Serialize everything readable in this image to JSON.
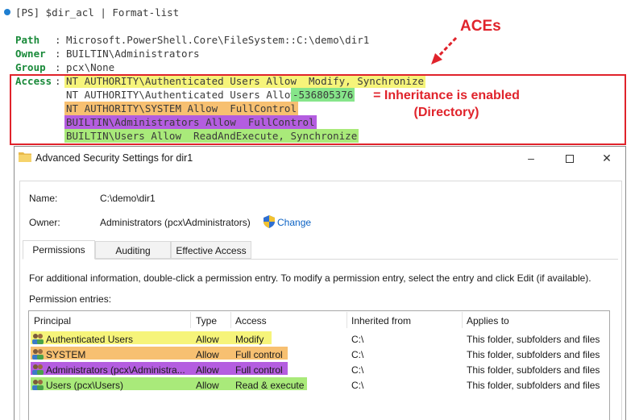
{
  "console": {
    "prompt": "[PS] $dir_acl | Format-list",
    "path_key": "Path",
    "path_value": "Microsoft.PowerShell.Core\\FileSystem::C:\\demo\\dir1",
    "owner_key": "Owner",
    "owner_value": "BUILTIN\\Administrators",
    "group_key": "Group",
    "group_value": "pcx\\None",
    "access_key": "Access",
    "aces": [
      "NT AUTHORITY\\Authenticated Users Allow  Modify, Synchronize",
      "NT AUTHORITY\\Authenticated Users Allow",
      "NT AUTHORITY\\SYSTEM Allow  FullControl",
      "BUILTIN\\Administrators Allow  FullControl",
      "BUILTIN\\Users Allow  ReadAndExecute, Synchronize"
    ],
    "inherit_flag_value": "-536805376"
  },
  "annotations": {
    "aces_label": "ACEs",
    "inheritance_line1": "= Inheritance is enabled",
    "inheritance_line2": "(Directory)",
    "color": "#e0232b"
  },
  "dialog": {
    "title": "Advanced Security Settings for dir1",
    "minimize_icon": "minimize-icon",
    "maximize_icon": "maximize-icon",
    "close_icon": "close-icon",
    "name_label": "Name:",
    "name_value": "C:\\demo\\dir1",
    "owner_label": "Owner:",
    "owner_value": "Administrators (pcx\\Administrators)",
    "change_link": "Change",
    "tabs": [
      "Permissions",
      "Auditing",
      "Effective Access"
    ],
    "info_text": "For additional information, double-click a permission entry. To modify a permission entry, select the entry and click Edit (if available).",
    "entries_label": "Permission entries:",
    "columns": [
      "Principal",
      "Type",
      "Access",
      "Inherited from",
      "Applies to"
    ],
    "rows": [
      {
        "principal": "Authenticated Users",
        "type": "Allow",
        "access": "Modify",
        "inherited": "C:\\",
        "applies": "This folder, subfolders and files",
        "highlight": "#f6f47a"
      },
      {
        "principal": "SYSTEM",
        "type": "Allow",
        "access": "Full control",
        "inherited": "C:\\",
        "applies": "This folder, subfolders and files",
        "highlight": "#f7c071"
      },
      {
        "principal": "Administrators (pcx\\Administra...",
        "type": "Allow",
        "access": "Full control",
        "inherited": "C:\\",
        "applies": "This folder, subfolders and files",
        "highlight": "#b45de0"
      },
      {
        "principal": "Users (pcx\\Users)",
        "type": "Allow",
        "access": "Read & execute",
        "inherited": "C:\\",
        "applies": "This folder, subfolders and files",
        "highlight": "#a9ea7a"
      }
    ]
  }
}
